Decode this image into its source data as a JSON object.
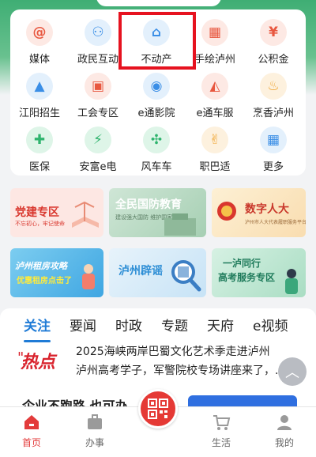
{
  "services": [
    {
      "label": "媒体",
      "icon": "at-icon",
      "color": "#e8573f",
      "bg": "#fde9e4",
      "glyph": "@"
    },
    {
      "label": "政民互动",
      "icon": "people-icon",
      "color": "#3a8ee6",
      "bg": "#e3f0fc",
      "glyph": "⚇"
    },
    {
      "label": "不动产",
      "icon": "house-icon",
      "color": "#3a8ee6",
      "bg": "#e3f0fc",
      "glyph": "⌂"
    },
    {
      "label": "手绘泸州",
      "icon": "map-icon",
      "color": "#e8573f",
      "bg": "#fde9e4",
      "glyph": "▦"
    },
    {
      "label": "公积金",
      "icon": "fund-icon",
      "color": "#e8573f",
      "bg": "#fde9e4",
      "glyph": "¥"
    },
    {
      "label": "江阳招生",
      "icon": "graduation-cap-icon",
      "color": "#3a8ee6",
      "bg": "#e3f0fc",
      "glyph": "▲"
    },
    {
      "label": "工会专区",
      "icon": "gift-icon",
      "color": "#e8573f",
      "bg": "#fde9e4",
      "glyph": "▣"
    },
    {
      "label": "e通影院",
      "icon": "camera-icon",
      "color": "#3a8ee6",
      "bg": "#e3f0fc",
      "glyph": "◉"
    },
    {
      "label": "e通车服",
      "icon": "car-icon",
      "color": "#e8573f",
      "bg": "#fde9e4",
      "glyph": "◭"
    },
    {
      "label": "烹香泸州",
      "icon": "food-icon",
      "color": "#f0a531",
      "bg": "#fdf1de",
      "glyph": "♨"
    },
    {
      "label": "医保",
      "icon": "medical-icon",
      "color": "#2fb46e",
      "bg": "#def5e8",
      "glyph": "✚"
    },
    {
      "label": "安富e电",
      "icon": "lightning-icon",
      "color": "#2fb46e",
      "bg": "#def5e8",
      "glyph": "⚡"
    },
    {
      "label": "风车车",
      "icon": "pinwheel-icon",
      "color": "#2fb46e",
      "bg": "#def5e8",
      "glyph": "✣"
    },
    {
      "label": "职巴适",
      "icon": "thumbs-up-icon",
      "color": "#f0a531",
      "bg": "#fdf1de",
      "glyph": "✌"
    },
    {
      "label": "更多",
      "icon": "grid-icon",
      "color": "#3a8ee6",
      "bg": "#e3f0fc",
      "glyph": "▦"
    }
  ],
  "banners": {
    "party": {
      "title": "党建专区",
      "subtitle": "不忘初心，牢记使命"
    },
    "defense": {
      "title": "全民国防教育",
      "subtitle": "建设强大国防 维护国家安全"
    },
    "npc": {
      "title": "数字人大",
      "subtitle": "泸州市人大代表履职服务平台"
    },
    "guide": {
      "title": "泸州租房攻略",
      "subtitle": "优惠租房点击了"
    },
    "rumor": {
      "title": "泸州辟谣"
    },
    "exam": {
      "title": "一泸同行",
      "title2": "高考服务专区"
    }
  },
  "tabs": [
    "关注",
    "要闻",
    "时政",
    "专题",
    "天府",
    "e视频"
  ],
  "hot_logo_text": "热点",
  "headlines": [
    "2025海峡两岸巴蜀文化艺术季走进泸州",
    "泸州高考学子，军警院校专场讲座来了，..."
  ],
  "peek_text": "企业不跑路   也可办",
  "tabbar": [
    {
      "label": "首页",
      "icon": "home-icon"
    },
    {
      "label": "办事",
      "icon": "briefcase-icon"
    },
    {
      "label": "生活",
      "icon": "cart-icon"
    },
    {
      "label": "我的",
      "icon": "user-icon"
    }
  ],
  "colors": {
    "accent": "#1f7bd6",
    "brand_red": "#e53935",
    "highlight": "#e6121f"
  }
}
